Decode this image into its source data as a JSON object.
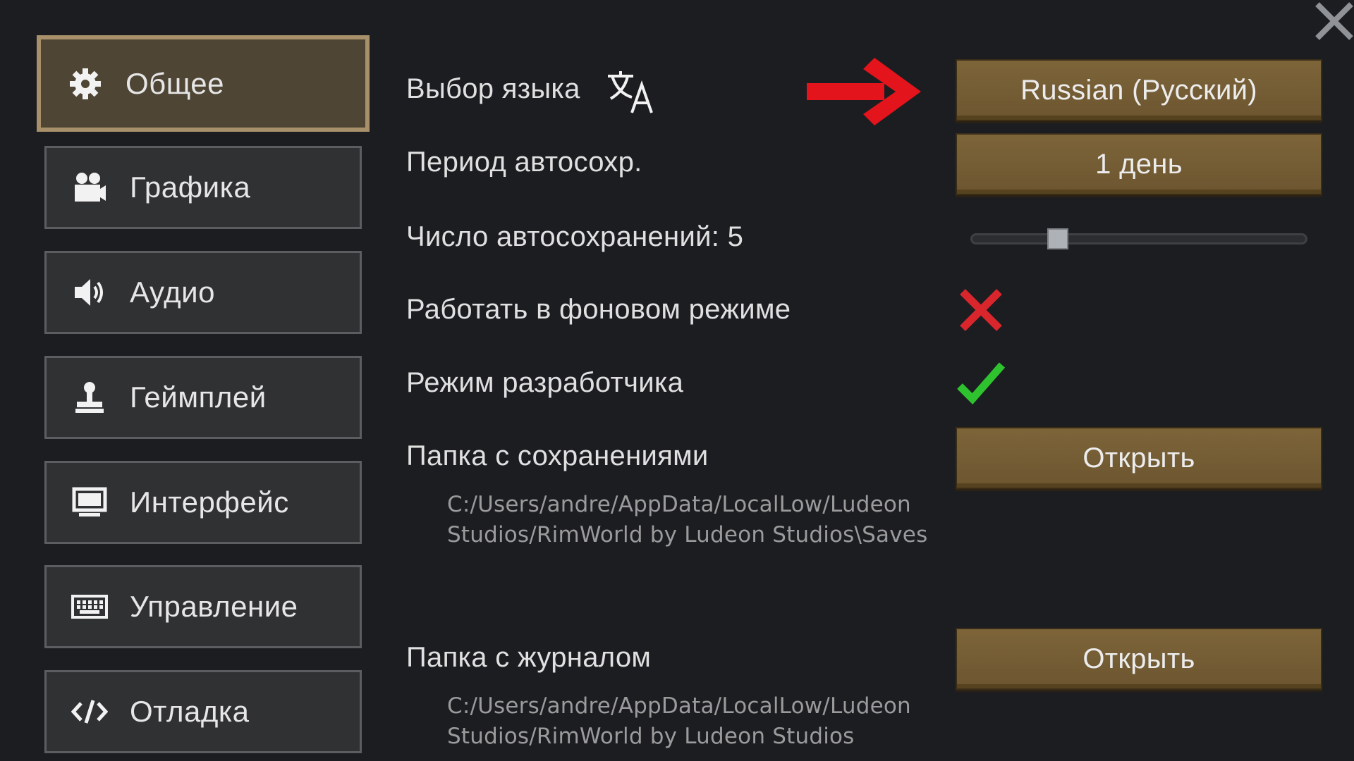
{
  "sidebar": {
    "items": [
      {
        "label": "Общее",
        "icon": "gear-icon",
        "active": true
      },
      {
        "label": "Графика",
        "icon": "camera-icon"
      },
      {
        "label": "Аудио",
        "icon": "speaker-icon"
      },
      {
        "label": "Геймплей",
        "icon": "gameplay-stamp-icon"
      },
      {
        "label": "Интерфейс",
        "icon": "monitor-icon"
      },
      {
        "label": "Управление",
        "icon": "keyboard-icon"
      },
      {
        "label": "Отладка",
        "icon": "code-icon"
      }
    ]
  },
  "settings": {
    "language": {
      "label": "Выбор языка",
      "value": "Russian (Русский)"
    },
    "autosave_period": {
      "label": "Период автосохр.",
      "value": "1 день"
    },
    "autosave_count": {
      "label": "Число автосохранений: 5",
      "value": 5,
      "min": 1,
      "max": 25
    },
    "run_in_background": {
      "label": "Работать в фоновом режиме",
      "checked": false
    },
    "dev_mode": {
      "label": "Режим разработчика",
      "checked": true
    },
    "saves_folder": {
      "label": "Папка с сохранениями",
      "button": "Открыть",
      "path_line1": "C:/Users/andre/AppData/LocalLow/Ludeon",
      "path_line2": "Studios/RimWorld by Ludeon Studios\\Saves"
    },
    "log_folder": {
      "label": "Папка с журналом",
      "button": "Открыть",
      "path_line1": "C:/Users/andre/AppData/LocalLow/Ludeon",
      "path_line2": "Studios/RimWorld by Ludeon Studios"
    }
  },
  "colors": {
    "background": "#1b1d21",
    "button": "#7d6439",
    "active_tab_border": "#a8916a",
    "arrow": "#e3141b",
    "cross": "#d9262d",
    "check": "#2fc22f"
  }
}
